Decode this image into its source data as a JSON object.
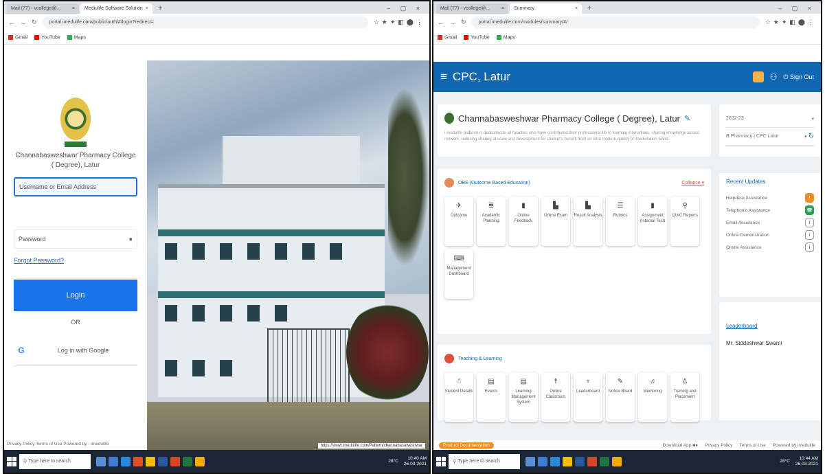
{
  "left": {
    "tabs": [
      {
        "label": "Mail (77) - vcollege@..."
      },
      {
        "label": "Mediulife Software Solution"
      }
    ],
    "url": "portal.imedulife.com/public/auth/#/login?redirect=",
    "bookmarks": [
      "Gmail",
      "YouTube",
      "Maps"
    ],
    "college_name": "Channabasweshwar Pharmacy College ( Degree), Latur",
    "username_placeholder": "Username or Email Address",
    "password_placeholder": "Password",
    "forgot_label": "Forgot Password?",
    "login_label": "Login",
    "or_label": "OR",
    "google_label": "Log in with Google",
    "footer": "Privacy Policy   Terms of Use   Powered by - imedulife",
    "photo_url_caption": "https://www.imedulife.com/Pattern/channabasaweshwar",
    "taskbar_search": "Type here to search",
    "tray_temp": "28°C",
    "tray_time": "10:40 AM",
    "tray_date": "26-03-2021"
  },
  "right": {
    "tabs": [
      {
        "label": "Mail (77) - vcollege@..."
      },
      {
        "label": "Summary"
      }
    ],
    "url": "portal.imedulife.com/modules/summary/#/",
    "bookmarks": [
      "Gmail",
      "YouTube",
      "Maps"
    ],
    "app_title": "CPC, Latur",
    "signout_label": "Sign Out",
    "college_title": "Channabasweshwar Pharmacy College ( Degree), Latur",
    "college_desc": "i-medulife platform is dedicated to all faculties who have contributed their professional life to learning innovations, sharing knowledge across network, reducing sharing at scale and development for student's benefit from an ultra modern quality of imeducation world.",
    "year_select": "2022-23",
    "program_select": "B.Pharmacy | CPC Latur",
    "obe_title": "OBE (Outcome Based Education)",
    "collapse_label": "Collapse",
    "obe_tiles": [
      {
        "icon": "✈",
        "label": "Outcome"
      },
      {
        "icon": "≣",
        "label": "Academic Planning"
      },
      {
        "icon": "▮",
        "label": "Online Feedback"
      },
      {
        "icon": "▙",
        "label": "Online Exam"
      },
      {
        "icon": "▙",
        "label": "Result Analysis"
      },
      {
        "icon": "☰",
        "label": "Rubrics"
      },
      {
        "icon": "▮",
        "label": "Assignment (Internal Test)"
      },
      {
        "icon": "⚲",
        "label": "QUIC Reports"
      },
      {
        "icon": "⌨",
        "label": "Management Dashboard"
      }
    ],
    "tl_title": "Teaching & Learning",
    "tl_tiles": [
      {
        "icon": "☃",
        "label": "Student Details"
      },
      {
        "icon": "▤",
        "label": "Events"
      },
      {
        "icon": "▤",
        "label": "Learning Management System"
      },
      {
        "icon": "☨",
        "label": "Online Classroom"
      },
      {
        "icon": "♆",
        "label": "Leaderboard"
      },
      {
        "icon": "✎",
        "label": "Notice Board"
      },
      {
        "icon": "♫",
        "label": "Mentoring"
      },
      {
        "icon": "♙",
        "label": "Training and Placement"
      }
    ],
    "updates_title": "Recent Updates",
    "updates": [
      {
        "label": "Helpdesk Assistance",
        "badge": "!",
        "color": "#f08a24"
      },
      {
        "label": "Telephonic Assistance",
        "badge": "☎",
        "color": "#2e9e4f"
      },
      {
        "label": "Email Assistance",
        "badge": "i",
        "color": "#ffffff"
      },
      {
        "label": "Online Demonstration",
        "badge": "i",
        "color": "#ffffff"
      },
      {
        "label": "Onsite Assistance",
        "badge": "i",
        "color": "#ffffff"
      }
    ],
    "leaderboard_title": "Leaderboard",
    "leaderboard_name": "Mr. Siddeshwar Swami",
    "footer_doc": "Product Documentation",
    "footer_download": "Download App",
    "footer_privacy": "Privacy Policy",
    "footer_terms": "Terms of Use",
    "footer_powered": "Powered by imedulife",
    "taskbar_search": "Type here to search",
    "tray_temp": "28°C",
    "tray_time": "10:44 AM",
    "tray_date": "26-03-2021"
  },
  "colors": {
    "primary": "#1167b1",
    "login_button": "#1a73e8",
    "taskbar": "#1c2533",
    "accent_orange": "#f08a24"
  }
}
